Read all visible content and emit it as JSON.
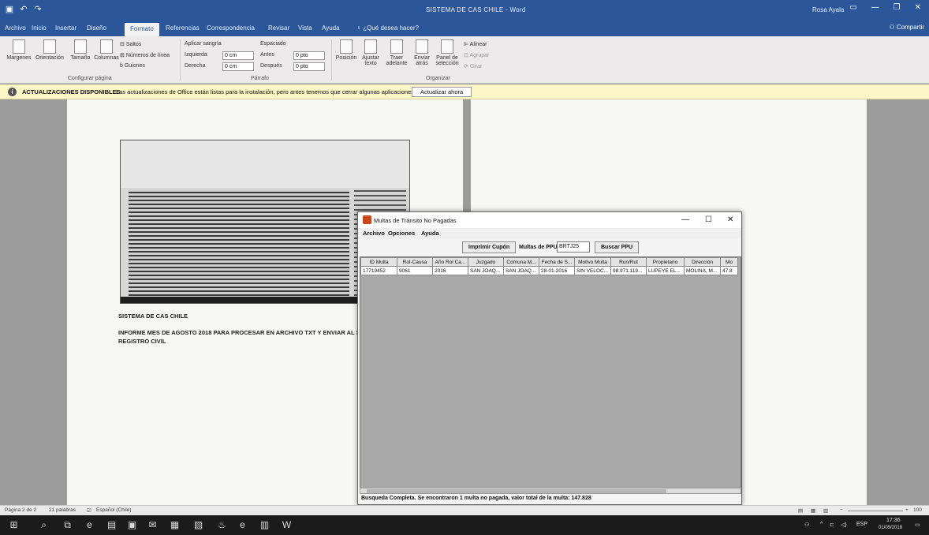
{
  "word": {
    "title": "SISTEMA DE CAS CHILE - Word",
    "user": "Rosa Ayala",
    "share": "Compartir",
    "tabs": [
      "Archivo",
      "Inicio",
      "Insertar",
      "Diseño",
      "Formato",
      "Referencias",
      "Correspondencia",
      "Revisar",
      "Vista",
      "Ayuda",
      "¿Qué desea hacer?"
    ],
    "ribbon": {
      "margenes": "Márgenes",
      "orientacion": "Orientación",
      "tamano": "Tamaño",
      "columnas": "Columnas",
      "saltos": "Saltos",
      "numeros_linea": "Números de línea",
      "guiones": "Guiones",
      "configurar_pagina": "Configurar página",
      "aplicar_sangria": "Aplicar sangría",
      "izquierda": "Izquierda",
      "izquierda_val": "0 cm",
      "derecha": "Derecha",
      "derecha_val": "0 cm",
      "espaciado": "Espaciado",
      "antes": "Antes",
      "antes_val": "0 pto",
      "despues": "Después",
      "despues_val": "0 pto",
      "parrafo": "Párrafo",
      "posicion": "Posición",
      "ajustar_texto": "Ajustar texto",
      "traer_adelante": "Traer adelante",
      "enviar_atras": "Enviar atrás",
      "panel_seleccion": "Panel de selección",
      "alinear": "Alinear",
      "agrupar": "Agrupar",
      "girar": "Girar",
      "organizar": "Organizar"
    },
    "message_bar": {
      "title": "ACTUALIZACIONES DISPONIBLES",
      "text": "Las actualizaciones de Office están listas para la instalación, pero antes tenemos que cerrar algunas aplicaciones.",
      "button": "Actualizar ahora"
    },
    "doc": {
      "line1": "SISTEMA DE CAS CHILE",
      "line2": "INFORME MES DE AGOSTO 2018 PARA PROCESAR EN ARCHIVO TXT Y ENVIAR AL S",
      "line3": "REGISTRO CIVIL"
    },
    "status": {
      "page": "Página 2 de 2",
      "words": "21 palabras",
      "lang": "Español (Chile)",
      "zoom": "100"
    }
  },
  "app": {
    "title": "Multas de Tránsito No Pagadas",
    "menu": [
      "Archivo",
      "Opciones",
      "Ayuda"
    ],
    "imprimir": "Imprimir Cupón",
    "ppu_label": "Multas de PPU",
    "ppu_value": "BRTJ25",
    "buscar": "Buscar PPU",
    "columns": [
      "ID Multa",
      "Rol-Causa",
      "Año Rol Ca...",
      "Juzgado",
      "Comuna M...",
      "Fecha de S...",
      "Motivo Multa",
      "Run/Rut",
      "Propietario",
      "Dirección",
      "Mo"
    ],
    "rows": [
      [
        "17719452",
        "9061",
        "2016",
        "SAN JOAQ...",
        "SAN JOAQ...",
        "28-01-2016",
        "SIN VELOC...",
        "98.971.119...",
        "LUPEYE EL...",
        "MOLINA, M...",
        "47.8"
      ]
    ],
    "status": "Busqueda Completa. Se encontraron 1 multa no pagada, valor total de la multa: 147.828"
  },
  "taskbar": {
    "time": "17:36",
    "date": "01/09/2018",
    "lang": "ESP"
  }
}
